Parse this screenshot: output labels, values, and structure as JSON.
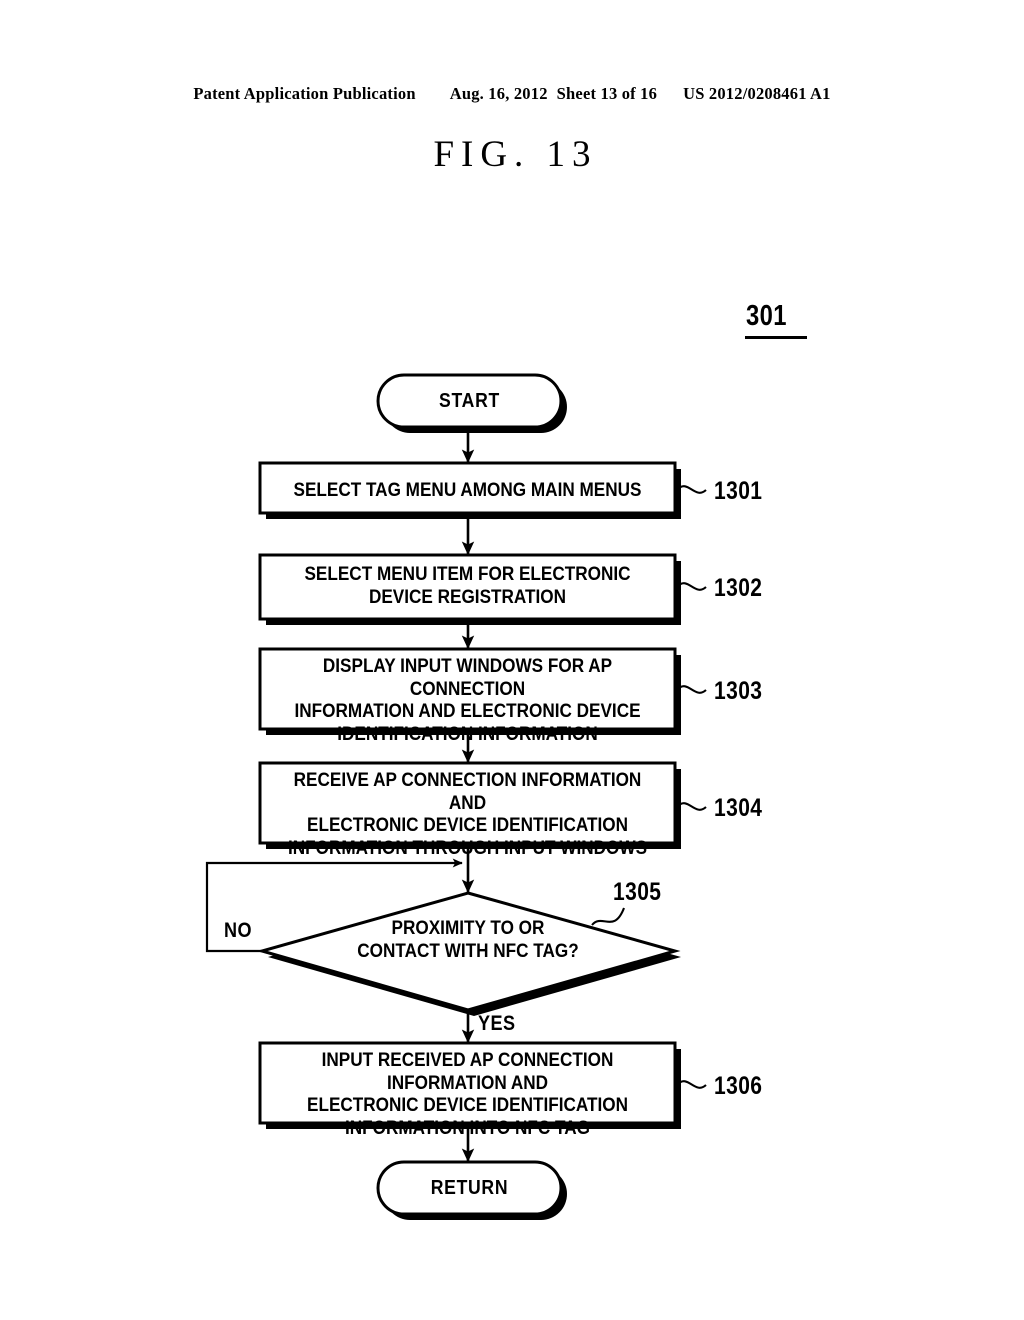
{
  "header": {
    "publication": "Patent Application Publication",
    "date": "Aug. 16, 2012",
    "sheet": "Sheet 13 of 16",
    "patent_number": "US 2012/0208461 A1"
  },
  "figure": {
    "title": "FIG.  13",
    "sheet_reference": "301"
  },
  "flowchart": {
    "start": {
      "label": "START"
    },
    "steps": [
      {
        "ref": "1301",
        "text": "SELECT TAG MENU AMONG MAIN MENUS"
      },
      {
        "ref": "1302",
        "text": "SELECT MENU ITEM FOR ELECTRONIC\nDEVICE REGISTRATION"
      },
      {
        "ref": "1303",
        "text": "DISPLAY INPUT WINDOWS FOR AP CONNECTION\nINFORMATION AND ELECTRONIC DEVICE\nIDENTIFICATION INFORMATION"
      },
      {
        "ref": "1304",
        "text": "RECEIVE AP CONNECTION INFORMATION AND\nELECTRONIC DEVICE IDENTIFICATION\nINFORMATION THROUGH INPUT WINDOWS"
      }
    ],
    "decision": {
      "ref": "1305",
      "text": "PROXIMITY TO OR\nCONTACT WITH NFC TAG?",
      "no_label": "NO",
      "yes_label": "YES"
    },
    "final_step": {
      "ref": "1306",
      "text": "INPUT RECEIVED AP CONNECTION INFORMATION AND\nELECTRONIC DEVICE IDENTIFICATION\nINFORMATION INTO NFC TAG"
    },
    "end": {
      "label": "RETURN"
    }
  },
  "colors": {
    "ink": "#000000",
    "paper": "#ffffff"
  }
}
